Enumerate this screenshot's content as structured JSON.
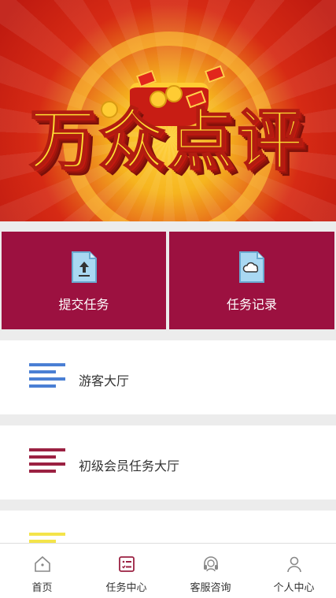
{
  "banner": {
    "title": "万众点评"
  },
  "actions": [
    {
      "label": "提交任务",
      "icon": "upload-file-icon"
    },
    {
      "label": "任务记录",
      "icon": "cloud-file-icon"
    }
  ],
  "list": [
    {
      "label": "游客大厅",
      "icon": "lines-icon",
      "color": "#4a7fd4"
    },
    {
      "label": "初级会员任务大厅",
      "icon": "lines-icon",
      "color": "#9b2142"
    },
    {
      "label": "",
      "icon": "lines-icon",
      "color": "#f4e44a"
    }
  ],
  "tabbar": {
    "active": 1,
    "items": [
      {
        "label": "首页",
        "icon": "home-icon"
      },
      {
        "label": "任务中心",
        "icon": "task-list-icon"
      },
      {
        "label": "客服咨询",
        "icon": "headset-icon"
      },
      {
        "label": "个人中心",
        "icon": "user-icon"
      }
    ]
  },
  "colors": {
    "tile": "#9c1140",
    "accent": "#9b2142"
  }
}
